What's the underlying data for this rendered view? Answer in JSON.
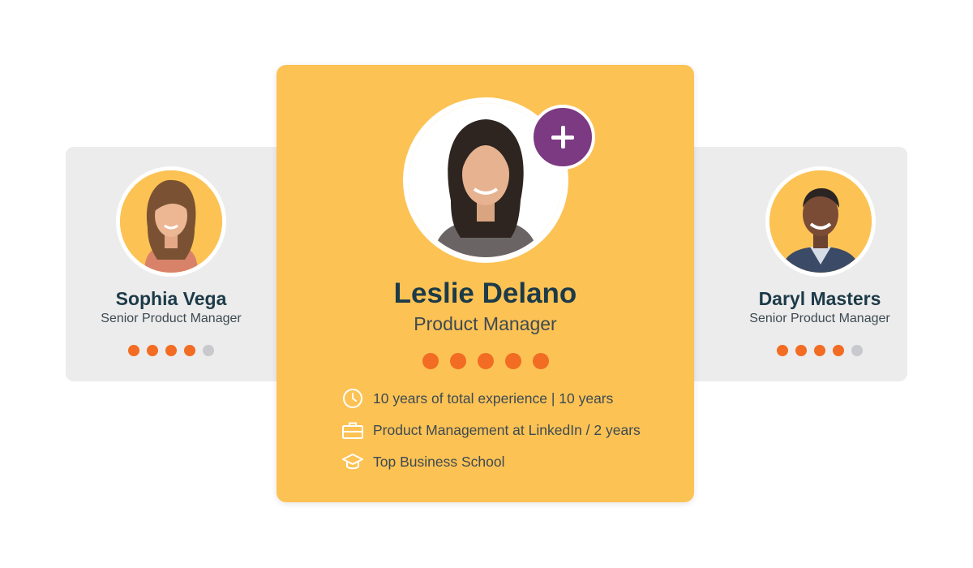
{
  "colors": {
    "accent_yellow": "#fcc254",
    "card_gray": "#ececec",
    "rating_orange": "#f26c23",
    "rating_off_gray": "#c7c9cd",
    "add_button_purple": "#7b3a82",
    "name_navy": "#1c3a48",
    "text_gray": "#3d4a52"
  },
  "profiles": {
    "left": {
      "name": "Sophia Vega",
      "title": "Senior Product Manager",
      "rating": 4,
      "rating_max": 5
    },
    "featured": {
      "name": "Leslie Delano",
      "title": "Product Manager",
      "rating": 5,
      "rating_max": 5,
      "add_icon": "plus-icon",
      "facts": [
        {
          "icon": "clock-icon",
          "text": "10 years of total experience | 10 years"
        },
        {
          "icon": "briefcase-icon",
          "text": "Product Management at LinkedIn / 2 years"
        },
        {
          "icon": "graduation-cap-icon",
          "text": "Top Business School"
        }
      ]
    },
    "right": {
      "name": "Daryl Masters",
      "title": "Senior Product Manager",
      "rating": 4,
      "rating_max": 5
    }
  }
}
